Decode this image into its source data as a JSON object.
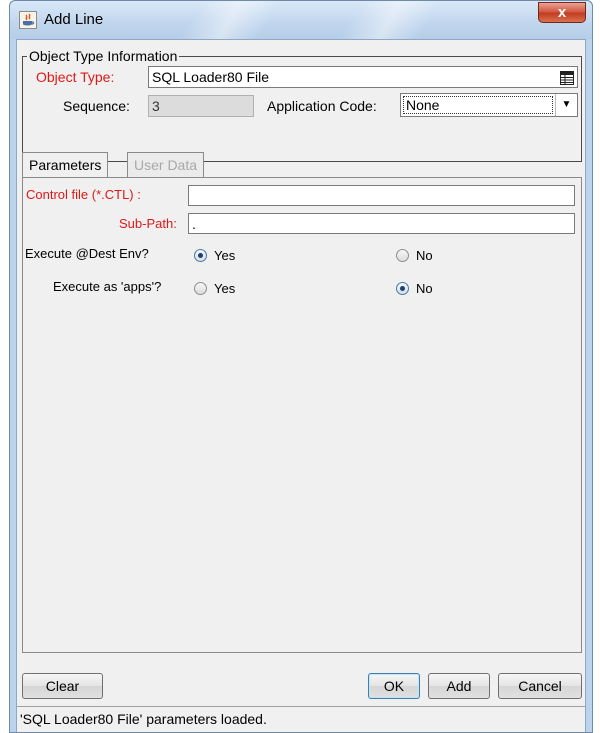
{
  "window": {
    "title": "Add Line",
    "close_label": "x"
  },
  "object_type_info": {
    "group_title": "Object Type Information",
    "object_type_label": "Object Type:",
    "object_type_value": "SQL Loader80 File",
    "sequence_label": "Sequence:",
    "sequence_value": "3",
    "app_code_label": "Application Code:",
    "app_code_value": "None"
  },
  "tabs": [
    {
      "label": "Parameters",
      "active": true
    },
    {
      "label": "User Data",
      "active": false
    }
  ],
  "parameters": {
    "control_file_label": "Control file (*.CTL) :",
    "control_file_value": "",
    "sub_path_label": "Sub-Path:",
    "sub_path_value": ".",
    "exec_dest_label": "Execute @Dest Env?",
    "exec_dest_yes": "Yes",
    "exec_dest_no": "No",
    "exec_dest_selected": "Yes",
    "exec_apps_label": "Execute as 'apps'?",
    "exec_apps_yes": "Yes",
    "exec_apps_no": "No",
    "exec_apps_selected": "No"
  },
  "buttons": {
    "clear": "Clear",
    "ok": "OK",
    "add": "Add",
    "cancel": "Cancel"
  },
  "status": {
    "message": "'SQL Loader80 File' parameters loaded."
  },
  "colors": {
    "required_label": "#e01818",
    "title_bar": "#c2d7ee",
    "close_button": "#c23a1e"
  }
}
